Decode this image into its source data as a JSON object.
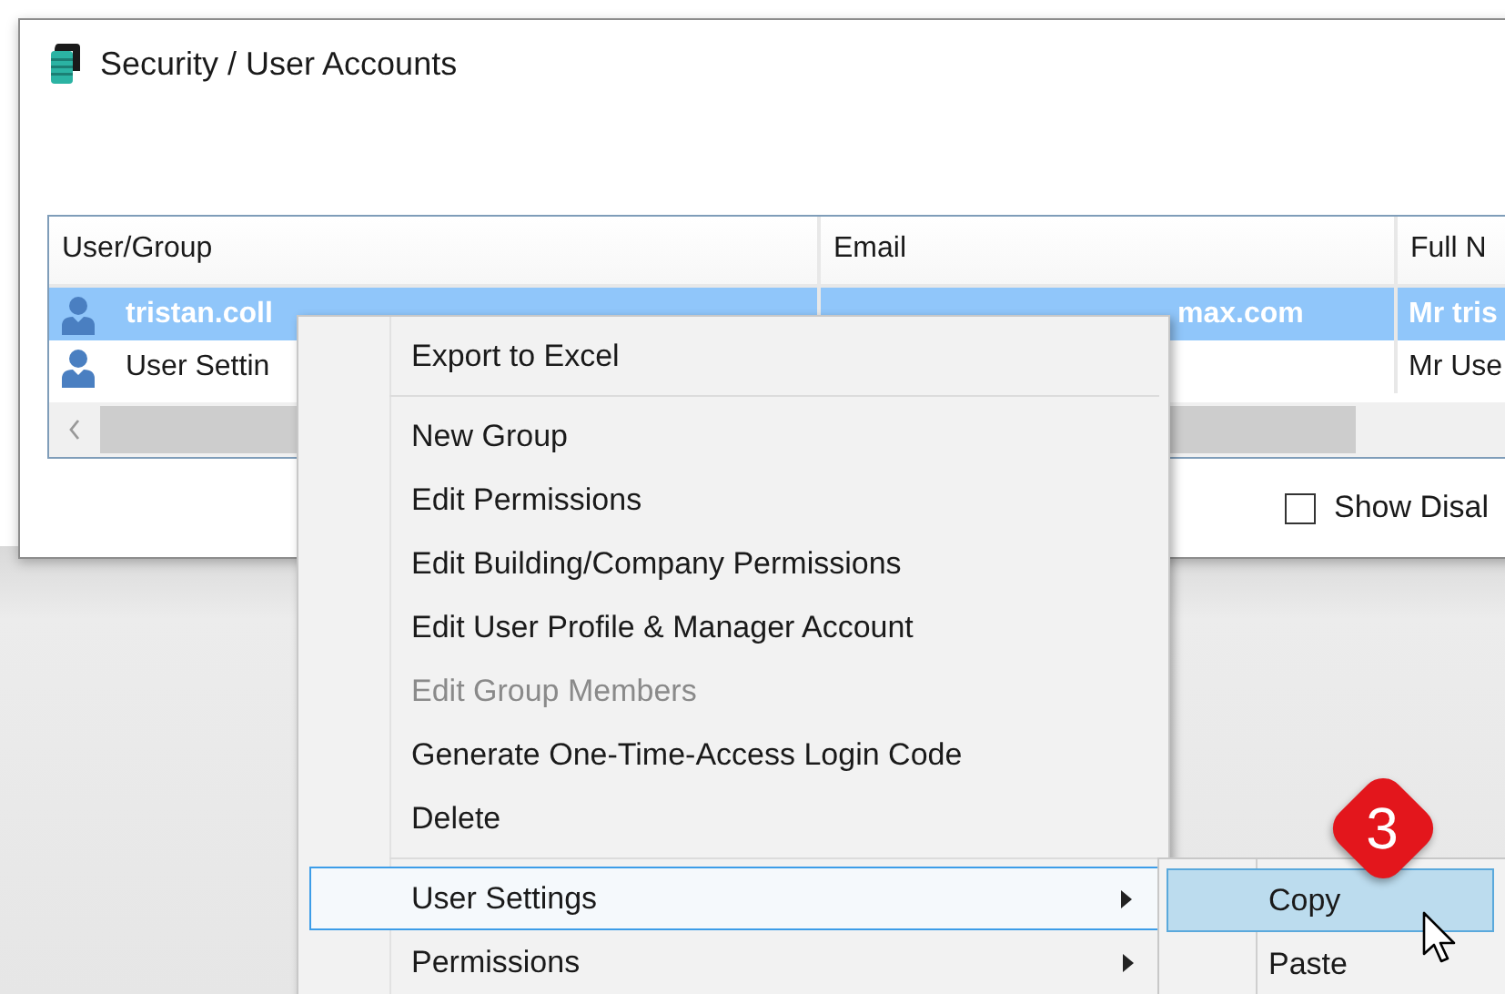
{
  "window": {
    "title": "Security / User Accounts"
  },
  "table": {
    "columns": [
      "User/Group",
      "Email",
      "Full N"
    ],
    "rows": [
      {
        "selected": true,
        "user_group": "tristan.coll",
        "email": "max.com",
        "column_3": "Mr tris"
      },
      {
        "selected": false,
        "user_group": "User Settin",
        "column_3": "Mr Use"
      }
    ]
  },
  "show_disabled": {
    "label": "Show Disal",
    "checked": false
  },
  "context_menu": {
    "items": [
      {
        "kind": "item",
        "label": "Export to Excel",
        "disabled": false,
        "submenu": false,
        "selected": false
      },
      {
        "kind": "separator"
      },
      {
        "kind": "item",
        "label": "New Group",
        "disabled": false,
        "submenu": false,
        "selected": false
      },
      {
        "kind": "item",
        "label": "Edit Permissions",
        "disabled": false,
        "submenu": false,
        "selected": false
      },
      {
        "kind": "item",
        "label": "Edit Building/Company Permissions",
        "disabled": false,
        "submenu": false,
        "selected": false
      },
      {
        "kind": "item",
        "label": "Edit User Profile & Manager Account",
        "disabled": false,
        "submenu": false,
        "selected": false
      },
      {
        "kind": "item",
        "label": "Edit Group Members",
        "disabled": true,
        "submenu": false,
        "selected": false
      },
      {
        "kind": "item",
        "label": "Generate One-Time-Access Login Code",
        "disabled": false,
        "submenu": false,
        "selected": false
      },
      {
        "kind": "item",
        "label": "Delete",
        "disabled": false,
        "submenu": false,
        "selected": false
      },
      {
        "kind": "separator"
      },
      {
        "kind": "item",
        "label": "User Settings",
        "disabled": false,
        "submenu": true,
        "selected": true
      },
      {
        "kind": "item",
        "label": "Permissions",
        "disabled": false,
        "submenu": true,
        "selected": false
      }
    ]
  },
  "submenu": {
    "items": [
      {
        "label": "Copy",
        "selected": true
      },
      {
        "label": "Paste",
        "selected": false
      }
    ]
  },
  "step_badge": {
    "label": "3"
  }
}
